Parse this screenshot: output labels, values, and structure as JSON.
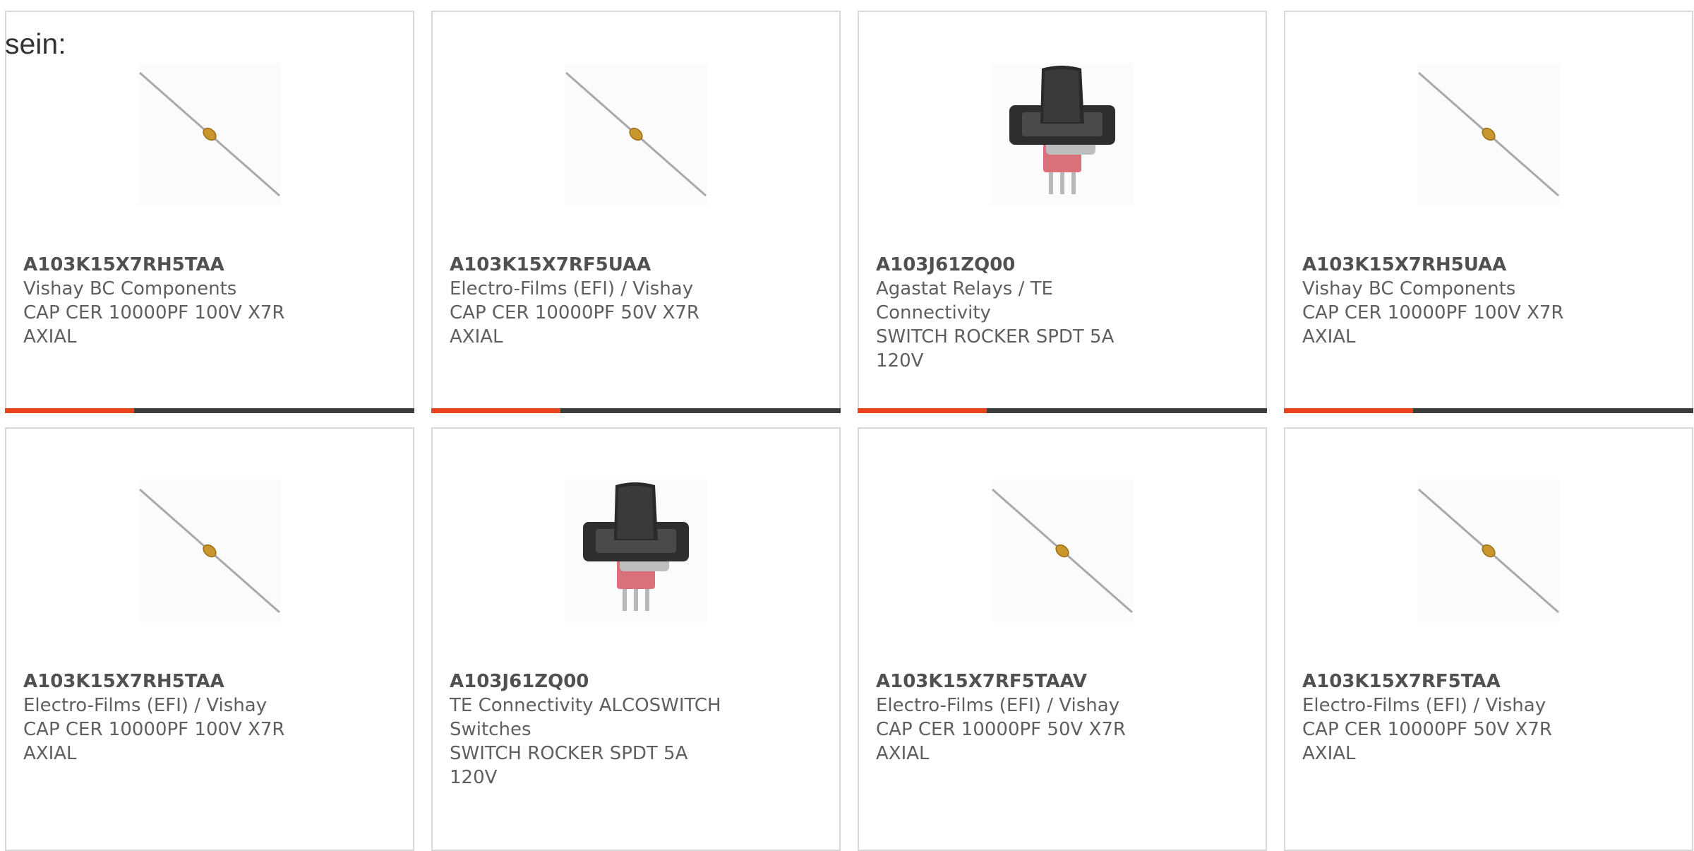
{
  "intro_text": "sein:",
  "colors": {
    "accent": "#e8441b",
    "bar": "#3d3d3d",
    "border": "#d9d9d9"
  },
  "products": [
    {
      "image": "capacitor-axial-image",
      "part_number": "A103K15X7RH5TAA",
      "manufacturer": "Vishay BC Components",
      "desc1": "CAP CER 10000PF 100V X7R",
      "desc2": "AXIAL",
      "desc3": ""
    },
    {
      "image": "capacitor-axial-image",
      "part_number": "A103K15X7RF5UAA",
      "manufacturer": "Electro-Films (EFI) / Vishay",
      "desc1": "CAP CER 10000PF 50V X7R AXIAL",
      "desc2": "",
      "desc3": ""
    },
    {
      "image": "rocker-switch-image",
      "part_number": "A103J61ZQ00",
      "manufacturer": "Agastat Relays / TE Connectivity",
      "desc1": "SWITCH ROCKER SPDT 5A 120V",
      "desc2": "",
      "desc3": ""
    },
    {
      "image": "capacitor-axial-image",
      "part_number": "A103K15X7RH5UAA",
      "manufacturer": "Vishay BC Components",
      "desc1": "CAP CER 10000PF 100V X7R",
      "desc2": "AXIAL",
      "desc3": ""
    },
    {
      "image": "capacitor-axial-image",
      "part_number": "A103K15X7RH5TAA",
      "manufacturer": "Electro-Films (EFI) / Vishay",
      "desc1": "CAP CER 10000PF 100V X7R",
      "desc2": "AXIAL",
      "desc3": ""
    },
    {
      "image": "rocker-switch-image",
      "part_number": "A103J61ZQ00",
      "manufacturer": "TE Connectivity ALCOSWITCH",
      "desc1": "Switches",
      "desc2": "SWITCH ROCKER SPDT 5A 120V",
      "desc3": ""
    },
    {
      "image": "capacitor-axial-image",
      "part_number": "A103K15X7RF5TAAV",
      "manufacturer": "Electro-Films (EFI) / Vishay",
      "desc1": "CAP CER 10000PF 50V X7R AXIAL",
      "desc2": "",
      "desc3": ""
    },
    {
      "image": "capacitor-axial-image",
      "part_number": "A103K15X7RF5TAA",
      "manufacturer": "Electro-Films (EFI) / Vishay",
      "desc1": "CAP CER 10000PF 50V X7R AXIAL",
      "desc2": "",
      "desc3": ""
    }
  ]
}
